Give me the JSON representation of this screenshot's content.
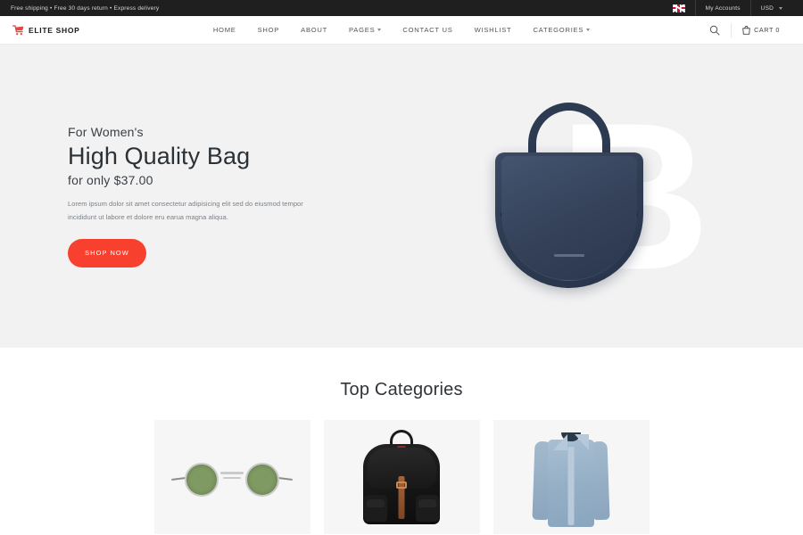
{
  "topbar": {
    "announcement": "Free shipping • Free 30 days return • Express delivery",
    "flag_icon": "uk-flag-icon",
    "account_label": "My Accounts",
    "currency_label": "USD",
    "currency_caret_icon": "caret-down-icon"
  },
  "header": {
    "logo_icon": "shopping-cart-icon",
    "logo_text": "ELITE SHOP",
    "nav": [
      {
        "label": "HOME",
        "has_dropdown": false
      },
      {
        "label": "SHOP",
        "has_dropdown": false
      },
      {
        "label": "ABOUT",
        "has_dropdown": false
      },
      {
        "label": "PAGES",
        "has_dropdown": true
      },
      {
        "label": "CONTACT US",
        "has_dropdown": false
      },
      {
        "label": "WISHLIST",
        "has_dropdown": false
      },
      {
        "label": "CATEGORIES",
        "has_dropdown": true
      }
    ],
    "search_icon": "search-icon",
    "cart_icon": "shopping-bag-icon",
    "cart_label": "CART 0"
  },
  "hero": {
    "eyebrow": "For Women's",
    "headline": "High Quality Bag",
    "subline": "for only $37.00",
    "description": "Lorem ipsum dolor sit amet consectetur adipisicing elit sed do eiusmod tempor incididunt ut labore et dolore eru earua magna aliqua.",
    "cta_label": "SHOP NOW",
    "watermark_letter": "B",
    "product_image_alt": "navy-handbag"
  },
  "categories": {
    "title": "Top Categories",
    "cards": [
      {
        "image_alt": "green-round-sunglasses"
      },
      {
        "image_alt": "black-leather-backpack"
      },
      {
        "image_alt": "blue-chambray-shirt"
      }
    ]
  },
  "colors": {
    "accent": "#F8402F",
    "topbar_bg": "#1F1F1F",
    "hero_bg": "#F2F2F3",
    "card_bg": "#F6F6F6",
    "product_navy": "#2F3C52"
  }
}
